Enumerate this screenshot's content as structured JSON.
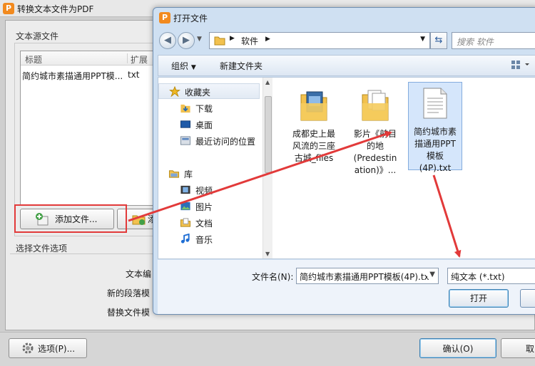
{
  "background_window": {
    "title": "转换文本文件为PDF",
    "app_icon_letter": "P",
    "source_group_label": "文本源文件",
    "columns": [
      "标题",
      "扩展"
    ],
    "files": [
      {
        "title": "简约城市素描通用PPT模...",
        "ext": "txt"
      }
    ],
    "add_files_label": "添加文件...",
    "add_folder_label_partial": "添",
    "options_group_label": "选择文件选项",
    "option_labels": [
      "文本编",
      "新的段落模",
      "替换文件模"
    ],
    "options_button": "选项(P)...",
    "ok_button": "确认(O)",
    "cancel_button_partial": "取"
  },
  "open_dialog": {
    "title": "打开文件",
    "app_icon_letter": "P",
    "address_crumb": "软件",
    "search_placeholder": "搜索 软件",
    "toolbar": {
      "organize": "组织",
      "new_folder": "新建文件夹"
    },
    "nav": {
      "favorites": "收藏夹",
      "favorites_items": [
        "下载",
        "桌面",
        "最近访问的位置"
      ],
      "library": "库",
      "library_items": [
        "视频",
        "图片",
        "文档",
        "音乐"
      ]
    },
    "files": [
      {
        "name": "成都史上最风流的三座古城_files",
        "lines": [
          "成都史上最",
          "风流的三座",
          "古城_files"
        ],
        "type": "folder"
      },
      {
        "name": "影片《前目的地(Predestination)》...",
        "lines": [
          "影片《前目",
          "的地",
          "(Predestin",
          "ation)》..."
        ],
        "type": "folder"
      },
      {
        "name": "简约城市素描通用PPT模板(4P).txt",
        "lines": [
          "简约城市素",
          "描通用PPT",
          "模板",
          "(4P).txt"
        ],
        "type": "text",
        "selected": true
      }
    ],
    "filename_label": "文件名(N):",
    "filename_value": "简约城市素描通用PPT模板(4P).tx",
    "filetype_value": "纯文本 (*.txt)",
    "open_button": "打开"
  },
  "colors": {
    "annotation_red": "#e23a3a",
    "accent_blue": "#2b5c9c"
  }
}
